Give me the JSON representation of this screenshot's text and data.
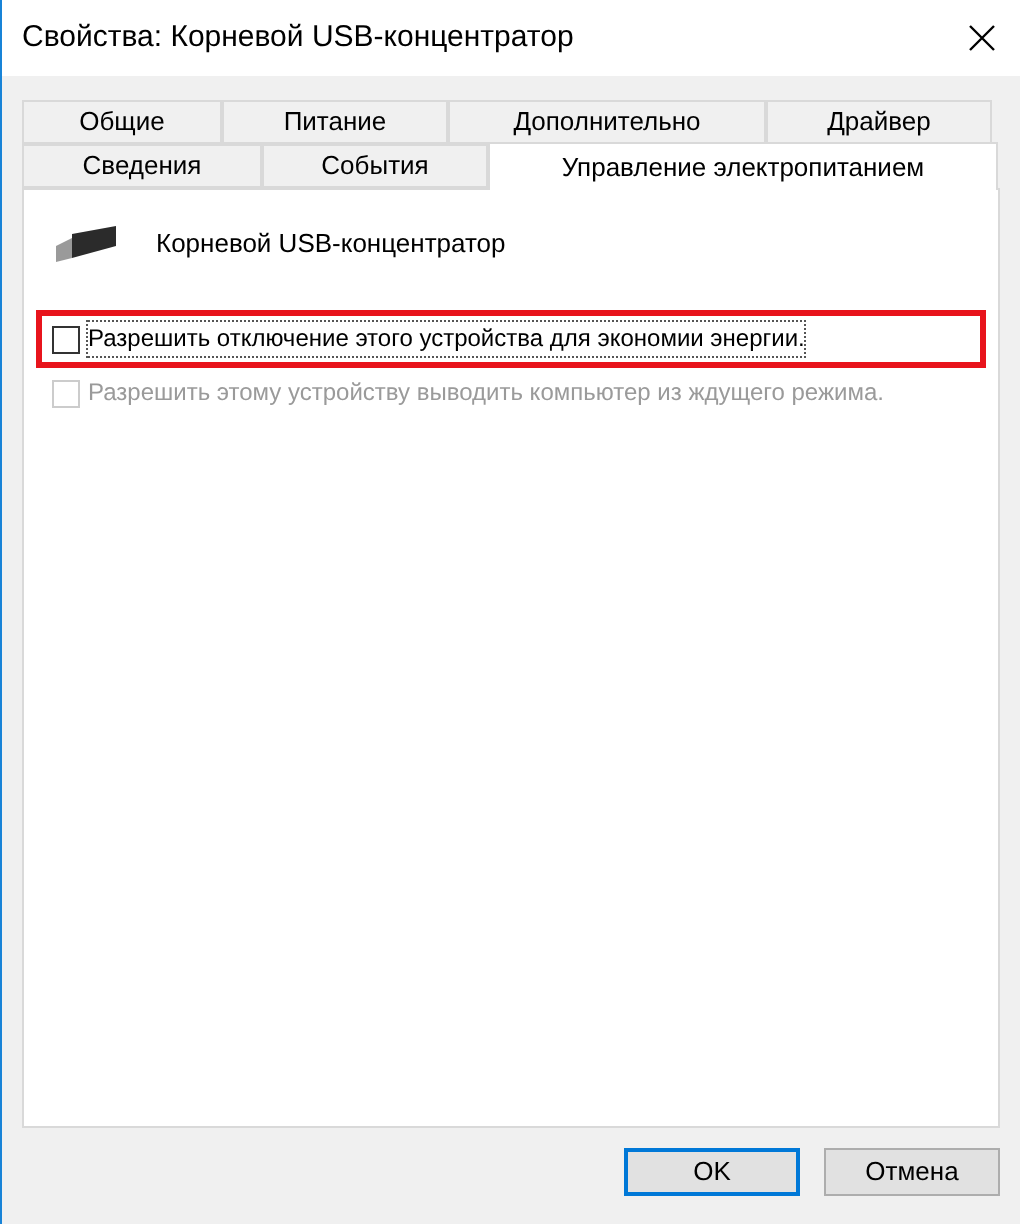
{
  "window": {
    "title": "Свойства: Корневой USB-концентратор"
  },
  "tab_rows": [
    [
      {
        "label": "Общие",
        "selected": false
      },
      {
        "label": "Питание",
        "selected": false
      },
      {
        "label": "Дополнительно",
        "selected": false
      },
      {
        "label": "Драйвер",
        "selected": false
      }
    ],
    [
      {
        "label": "Сведения",
        "selected": false
      },
      {
        "label": "События",
        "selected": false
      },
      {
        "label": "Управление электропитанием",
        "selected": true
      }
    ]
  ],
  "device": {
    "name": "Корневой USB-концентратор"
  },
  "options": [
    {
      "label": "Разрешить отключение этого устройства для экономии энергии.",
      "checked": false,
      "disabled": false,
      "focused": true,
      "highlighted": true
    },
    {
      "label": "Разрешить этому устройству выводить компьютер из ждущего режима.",
      "checked": false,
      "disabled": true,
      "focused": false,
      "highlighted": false
    }
  ],
  "buttons": [
    {
      "label": "OK",
      "default": true
    },
    {
      "label": "Отмена",
      "default": false
    }
  ]
}
